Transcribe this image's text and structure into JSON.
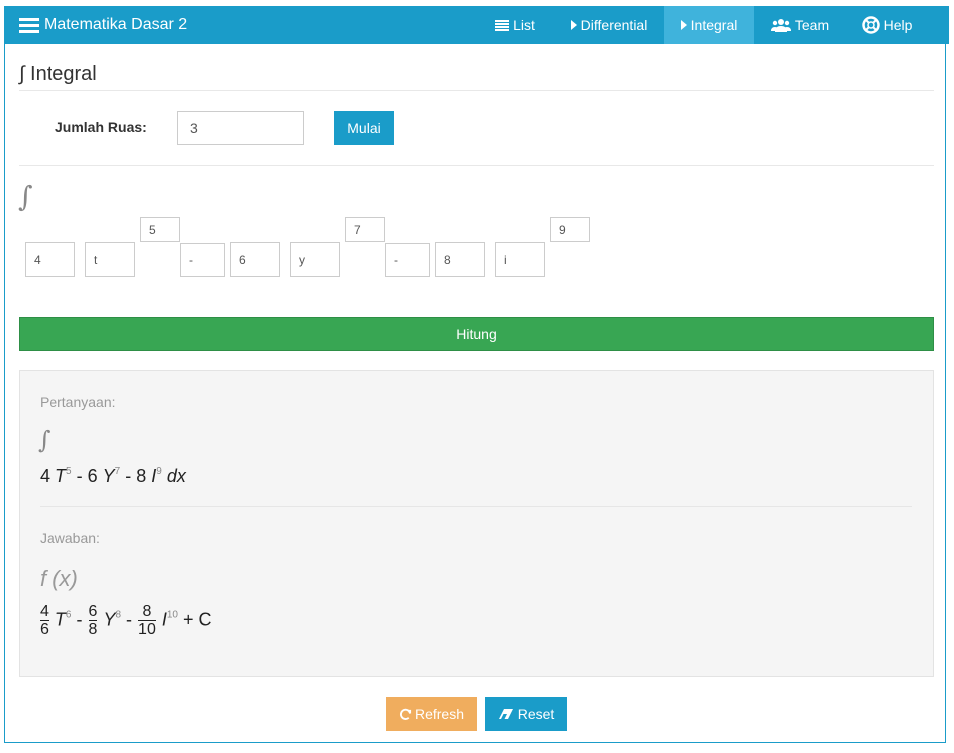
{
  "navbar": {
    "brand": "Matematika Dasar 2",
    "items": [
      {
        "label": "List",
        "icon": "list-icon"
      },
      {
        "label": "Differential",
        "icon": "caret-right-icon"
      },
      {
        "label": "Integral",
        "icon": "caret-right-icon",
        "active": true
      },
      {
        "label": "Team",
        "icon": "users-icon"
      },
      {
        "label": "Help",
        "icon": "lifebuoy-icon"
      }
    ]
  },
  "page": {
    "title": "∫ Integral",
    "jumlah_ruas_label": "Jumlah Ruas:",
    "jumlah_ruas_value": "3",
    "mulai_label": "Mulai",
    "integral_symbol": "∫",
    "terms": [
      {
        "coef": "4",
        "var": "t",
        "exp": "5",
        "op": "-"
      },
      {
        "coef": "6",
        "var": "y",
        "exp": "7",
        "op": "-"
      },
      {
        "coef": "8",
        "var": "i",
        "exp": "9"
      }
    ],
    "hitung_label": "Hitung"
  },
  "result": {
    "pertanyaan_label": "Pertanyaan:",
    "question_integral": "∫",
    "question": {
      "t1": {
        "coef": "4",
        "var": "T",
        "exp": "5"
      },
      "op1": "- 6",
      "t2": {
        "var": "Y",
        "exp": "7"
      },
      "op2": "- 8",
      "t3": {
        "var": "I",
        "exp": "9"
      },
      "suffix": "dx"
    },
    "jawaban_label": "Jawaban:",
    "fx_label": "f (x)",
    "answer": {
      "f1": {
        "num": "4",
        "den": "6",
        "var": "T",
        "exp": "6"
      },
      "f2": {
        "num": "6",
        "den": "8",
        "var": "Y",
        "exp": "8"
      },
      "f3": {
        "num": "8",
        "den": "10",
        "var": "I",
        "exp": "10"
      },
      "op": "-",
      "suffix": "+ C"
    }
  },
  "actions": {
    "refresh_label": "Refresh",
    "reset_label": "Reset"
  },
  "colors": {
    "primary": "#1a9cc9",
    "success": "#38a653",
    "warning": "#f0ad5e",
    "active_nav": "#3fb3dc"
  }
}
